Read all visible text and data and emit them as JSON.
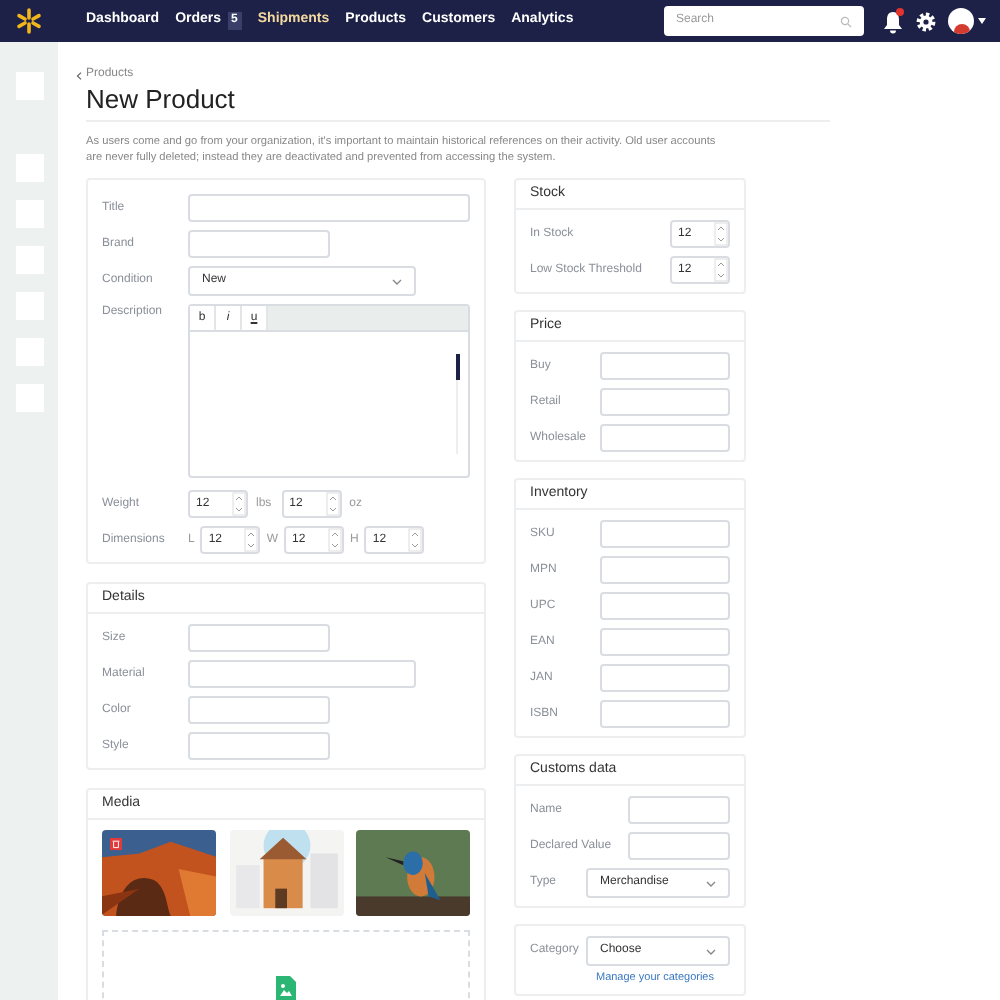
{
  "nav": {
    "items": [
      {
        "label": "Dashboard",
        "selected": false
      },
      {
        "label": "Orders",
        "badge": "5",
        "selected": false
      },
      {
        "label": "Shipments",
        "selected": true
      },
      {
        "label": "Products",
        "selected": false
      },
      {
        "label": "Customers",
        "selected": false
      },
      {
        "label": "Analytics",
        "selected": false
      }
    ],
    "search": {
      "placeholder": "Search"
    },
    "notifications": {
      "unread": true
    }
  },
  "breadcrumb": "Products",
  "title": "New Product",
  "intro": "As users come and go from your organization, it's important to maintain historical references on their activity. Old user accounts are never fully deleted; instead they are deactivated and prevented from accessing the system.",
  "main_form": {
    "fields": [
      {
        "kind": "long",
        "label": "Title"
      },
      {
        "kind": "short",
        "label": "Brand"
      },
      {
        "kind": "select",
        "label": "Condition",
        "value": "New"
      },
      {
        "kind": "editor",
        "label": "Description",
        "tools": [
          "b",
          "i",
          "u"
        ]
      },
      {
        "kind": "pair",
        "label": "Weight",
        "parts": [
          {
            "value": "12",
            "unit": "lbs"
          },
          {
            "value": "12",
            "unit": "oz"
          }
        ]
      },
      {
        "kind": "dims",
        "label": "Dimensions",
        "parts": [
          {
            "prefix": "L",
            "value": "12"
          },
          {
            "prefix": "W",
            "value": "12"
          },
          {
            "prefix": "H",
            "value": "12"
          }
        ]
      }
    ]
  },
  "details": {
    "title": "Details",
    "fields": [
      {
        "kind": "short",
        "label": "Size"
      },
      {
        "kind": "long",
        "label": "Material"
      },
      {
        "kind": "short",
        "label": "Color"
      },
      {
        "kind": "short",
        "label": "Style"
      }
    ]
  },
  "media": {
    "title": "Media",
    "images": [
      {
        "kind": "picture",
        "deletable": true
      },
      {
        "kind": "picture",
        "deletable": false
      },
      {
        "kind": "picture",
        "deletable": false
      }
    ]
  },
  "stock": {
    "title": "Stock",
    "fields": [
      {
        "label": "In Stock",
        "value": "12"
      },
      {
        "label": "Low Stock Threshold",
        "value": "12"
      }
    ]
  },
  "price": {
    "title": "Price",
    "fields": [
      {
        "label": "Buy"
      },
      {
        "label": "Retail"
      },
      {
        "label": "Wholesale"
      }
    ]
  },
  "inventory": {
    "title": "Inventory",
    "fields": [
      {
        "label": "SKU"
      },
      {
        "label": "MPN"
      },
      {
        "label": "UPC"
      },
      {
        "label": "EAN"
      },
      {
        "label": "JAN"
      },
      {
        "label": "ISBN"
      }
    ]
  },
  "customs": {
    "title": "Customs data",
    "fields": [
      {
        "kind": "text",
        "label": "Name"
      },
      {
        "kind": "text",
        "label": "Declared Value"
      },
      {
        "kind": "select",
        "label": "Type",
        "value": "Merchandise"
      }
    ]
  },
  "category": {
    "label": "Category",
    "value": "Choose",
    "link": "Manage your categories"
  }
}
